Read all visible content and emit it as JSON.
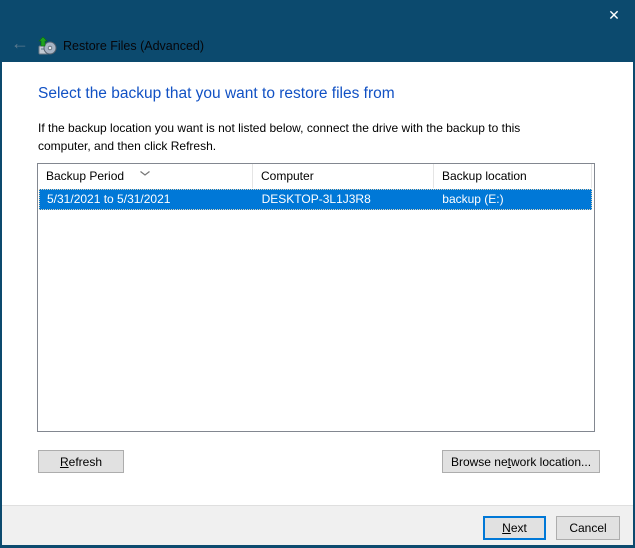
{
  "colors": {
    "titlebar": "#0C4A6E",
    "heading_text": "#1151C4",
    "selection": "#0078D7",
    "footer": "#F0F0F0",
    "button_face": "#E1E1E1",
    "button_border": "#ADADAD",
    "focus_border": "#0078D7"
  },
  "titlebar": {
    "close_icon": "✕"
  },
  "nav": {
    "back_icon": "←",
    "app_icon": "restore-files-icon",
    "title": "Restore Files (Advanced)"
  },
  "content": {
    "heading": "Select the backup that you want to restore files from",
    "instruction_lines": [
      "If the backup location you want is not listed below, connect the drive with the backup to this",
      "computer, and then click Refresh."
    ]
  },
  "table": {
    "columns": [
      {
        "label": "Backup Period",
        "sorted": "descending"
      },
      {
        "label": "Computer",
        "sorted": ""
      },
      {
        "label": "Backup location",
        "sorted": ""
      }
    ],
    "sort_icon": "chevron-down",
    "rows": [
      {
        "backup_period": "5/31/2021 to 5/31/2021",
        "computer": "DESKTOP-3L1J3R8",
        "backup_location": "backup (E:)",
        "selected": true
      }
    ]
  },
  "buttons": {
    "refresh": {
      "accel": "R",
      "rest": "efresh"
    },
    "browse": {
      "pre": "Browse ne",
      "accel": "t",
      "post": "work location..."
    },
    "next": {
      "accel": "N",
      "rest": "ext"
    },
    "cancel": "Cancel"
  }
}
